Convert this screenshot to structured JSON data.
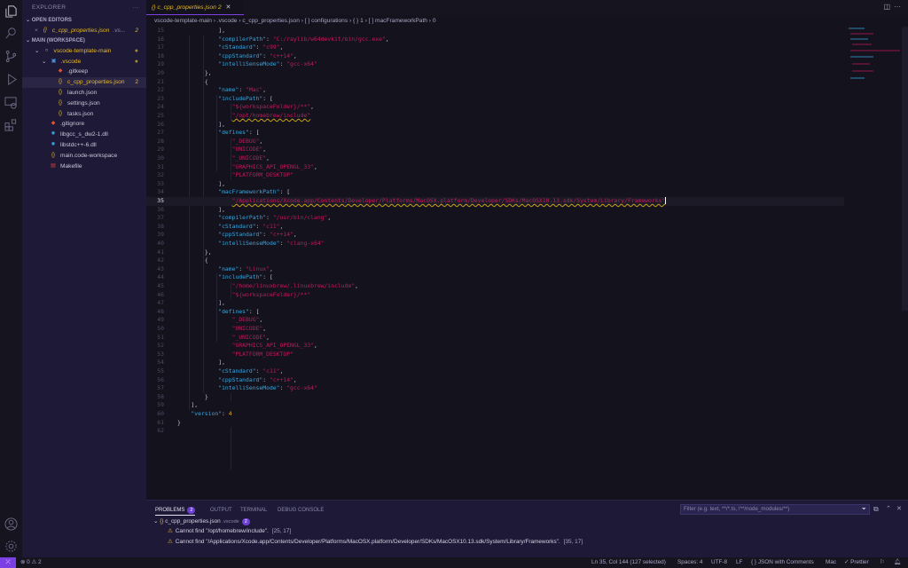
{
  "activity": [
    "explorer-icon",
    "search-icon",
    "source-control-icon",
    "run-debug-icon",
    "remote-explorer-icon",
    "extensions-icon",
    "account-icon",
    "settings-gear-icon"
  ],
  "sidebar": {
    "title": "EXPLORER",
    "more": "···",
    "open_editors": "OPEN EDITORS",
    "open_file": {
      "name": "c_cpp_properties.json",
      "dir": ".vs...",
      "count": "2"
    },
    "workspace": "MAIN (WORKSPACE)",
    "tree": [
      {
        "label": "vscode-template-main",
        "depth": 1,
        "icon": "○",
        "cls": "yellow",
        "dot": "●"
      },
      {
        "label": ".vscode",
        "depth": 2,
        "icon": "▣",
        "cls": "yellow",
        "dot": "●",
        "iconcolor": "#4a8fd6"
      },
      {
        "label": ".gitkeep",
        "depth": 3,
        "icon": "◆",
        "iconcolor": "#e0532e"
      },
      {
        "label": "c_cpp_properties.json",
        "depth": 3,
        "icon": "{}",
        "cls": "yellow",
        "count": "2",
        "selected": true,
        "iconcolor": "#e8b923"
      },
      {
        "label": "launch.json",
        "depth": 3,
        "icon": "{}",
        "iconcolor": "#e8b923"
      },
      {
        "label": "settings.json",
        "depth": 3,
        "icon": "{}",
        "iconcolor": "#e8b923"
      },
      {
        "label": "tasks.json",
        "depth": 3,
        "icon": "{}",
        "iconcolor": "#e8b923"
      },
      {
        "label": ".gitignore",
        "depth": 2,
        "icon": "◆",
        "iconcolor": "#e0532e"
      },
      {
        "label": "libgcc_s_dw2-1.dll",
        "depth": 2,
        "icon": "✹",
        "iconcolor": "#3a9de0"
      },
      {
        "label": "libstdc++-6.dll",
        "depth": 2,
        "icon": "✹",
        "iconcolor": "#3a9de0"
      },
      {
        "label": "main.code-workspace",
        "depth": 2,
        "icon": "{}",
        "iconcolor": "#e8b923"
      },
      {
        "label": "Makefile",
        "depth": 2,
        "icon": "▤",
        "iconcolor": "#e0403a"
      }
    ]
  },
  "tab": {
    "label": "c_cpp_properties.json",
    "count": "2"
  },
  "breadcrumb": [
    "vscode-template-main",
    ".vscode",
    "c_cpp_properties.json",
    "[ ] configurations",
    "{ } 1",
    "[ ] macFrameworkPath",
    "0"
  ],
  "code": [
    {
      "n": 15,
      "i": 12,
      "t": [
        [
          "p",
          "],"
        ]
      ]
    },
    {
      "n": 16,
      "i": 12,
      "t": [
        [
          "k",
          "\"compilerPath\""
        ],
        [
          "p",
          ": "
        ],
        [
          "s",
          "\"C:/raylib/w64devkit/bin/gcc.exe\""
        ],
        [
          "p",
          ","
        ]
      ]
    },
    {
      "n": 17,
      "i": 12,
      "t": [
        [
          "k",
          "\"cStandard\""
        ],
        [
          "p",
          ": "
        ],
        [
          "s",
          "\"c99\""
        ],
        [
          "p",
          ","
        ]
      ]
    },
    {
      "n": 18,
      "i": 12,
      "t": [
        [
          "k",
          "\"cppStandard\""
        ],
        [
          "p",
          ": "
        ],
        [
          "s",
          "\"c++14\""
        ],
        [
          "p",
          ","
        ]
      ]
    },
    {
      "n": 19,
      "i": 12,
      "t": [
        [
          "k",
          "\"intelliSenseMode\""
        ],
        [
          "p",
          ": "
        ],
        [
          "s",
          "\"gcc-x64\""
        ]
      ]
    },
    {
      "n": 20,
      "i": 8,
      "t": [
        [
          "p",
          "},"
        ]
      ]
    },
    {
      "n": 21,
      "i": 8,
      "t": [
        [
          "p",
          "{"
        ]
      ]
    },
    {
      "n": 22,
      "i": 12,
      "t": [
        [
          "k",
          "\"name\""
        ],
        [
          "p",
          ": "
        ],
        [
          "s",
          "\"Mac\""
        ],
        [
          "p",
          ","
        ]
      ]
    },
    {
      "n": 23,
      "i": 12,
      "t": [
        [
          "k",
          "\"includePath\""
        ],
        [
          "p",
          ": ["
        ]
      ]
    },
    {
      "n": 24,
      "i": 16,
      "t": [
        [
          "s",
          "\"${workspaceFolder}/**\""
        ],
        [
          "p",
          ","
        ]
      ]
    },
    {
      "n": 25,
      "i": 16,
      "t": [
        [
          "s sq",
          "\"/opt/homebrew/include\""
        ]
      ]
    },
    {
      "n": 26,
      "i": 12,
      "t": [
        [
          "p",
          "],"
        ]
      ]
    },
    {
      "n": 27,
      "i": 12,
      "t": [
        [
          "k",
          "\"defines\""
        ],
        [
          "p",
          ": ["
        ]
      ]
    },
    {
      "n": 28,
      "i": 16,
      "t": [
        [
          "s",
          "\"_DEBUG\""
        ],
        [
          "p",
          ","
        ]
      ]
    },
    {
      "n": 29,
      "i": 16,
      "t": [
        [
          "s",
          "\"UNICODE\""
        ],
        [
          "p",
          ","
        ]
      ]
    },
    {
      "n": 30,
      "i": 16,
      "t": [
        [
          "s",
          "\"_UNICODE\""
        ],
        [
          "p",
          ","
        ]
      ]
    },
    {
      "n": 31,
      "i": 16,
      "t": [
        [
          "s",
          "\"GRAPHICS_API_OPENGL_33\""
        ],
        [
          "p",
          ","
        ]
      ]
    },
    {
      "n": 32,
      "i": 16,
      "t": [
        [
          "s",
          "\"PLATFORM_DESKTOP\""
        ]
      ]
    },
    {
      "n": 33,
      "i": 12,
      "t": [
        [
          "p",
          "],"
        ]
      ]
    },
    {
      "n": 34,
      "i": 12,
      "t": [
        [
          "k",
          "\"macFrameworkPath\""
        ],
        [
          "p",
          ": ["
        ]
      ]
    },
    {
      "n": 35,
      "i": 16,
      "cur": true,
      "t": [
        [
          "s sq",
          "\"/Applications/Xcode.app/Contents/Developer/Platforms/MacOSX.platform/Developer/SDKs/MacOSX10.13.sdk/System/Library/Frameworks\""
        ]
      ]
    },
    {
      "n": 36,
      "i": 12,
      "t": [
        [
          "p",
          "],"
        ]
      ]
    },
    {
      "n": 37,
      "i": 12,
      "t": [
        [
          "k",
          "\"compilerPath\""
        ],
        [
          "p",
          ": "
        ],
        [
          "s",
          "\"/usr/bin/clang\""
        ],
        [
          "p",
          ","
        ]
      ]
    },
    {
      "n": 38,
      "i": 12,
      "t": [
        [
          "k",
          "\"cStandard\""
        ],
        [
          "p",
          ": "
        ],
        [
          "s",
          "\"c11\""
        ],
        [
          "p",
          ","
        ]
      ]
    },
    {
      "n": 39,
      "i": 12,
      "t": [
        [
          "k",
          "\"cppStandard\""
        ],
        [
          "p",
          ": "
        ],
        [
          "s",
          "\"c++14\""
        ],
        [
          "p",
          ","
        ]
      ]
    },
    {
      "n": 40,
      "i": 12,
      "t": [
        [
          "k",
          "\"intelliSenseMode\""
        ],
        [
          "p",
          ": "
        ],
        [
          "s",
          "\"clang-x64\""
        ]
      ]
    },
    {
      "n": 41,
      "i": 8,
      "t": [
        [
          "p",
          "},"
        ]
      ]
    },
    {
      "n": 42,
      "i": 8,
      "t": [
        [
          "p",
          "{"
        ]
      ]
    },
    {
      "n": 43,
      "i": 12,
      "t": [
        [
          "k",
          "\"name\""
        ],
        [
          "p",
          ": "
        ],
        [
          "s",
          "\"Linux\""
        ],
        [
          "p",
          ","
        ]
      ]
    },
    {
      "n": 44,
      "i": 12,
      "t": [
        [
          "k",
          "\"includePath\""
        ],
        [
          "p",
          ": ["
        ]
      ]
    },
    {
      "n": 45,
      "i": 16,
      "t": [
        [
          "s",
          "\"/home/linuxbrew/.linuxbrew/include\""
        ],
        [
          "p",
          ","
        ]
      ]
    },
    {
      "n": 46,
      "i": 16,
      "t": [
        [
          "s",
          "\"${workspaceFolder}/**\""
        ]
      ]
    },
    {
      "n": 47,
      "i": 12,
      "t": [
        [
          "p",
          "],"
        ]
      ]
    },
    {
      "n": 48,
      "i": 12,
      "t": [
        [
          "k",
          "\"defines\""
        ],
        [
          "p",
          ": ["
        ]
      ]
    },
    {
      "n": 49,
      "i": 16,
      "t": [
        [
          "s",
          "\"_DEBUG\""
        ],
        [
          "p",
          ","
        ]
      ]
    },
    {
      "n": 50,
      "i": 16,
      "t": [
        [
          "s",
          "\"UNICODE\""
        ],
        [
          "p",
          ","
        ]
      ]
    },
    {
      "n": 51,
      "i": 16,
      "t": [
        [
          "s",
          "\"_UNICODE\""
        ],
        [
          "p",
          ","
        ]
      ]
    },
    {
      "n": 52,
      "i": 16,
      "t": [
        [
          "s",
          "\"GRAPHICS_API_OPENGL_33\""
        ],
        [
          "p",
          ","
        ]
      ]
    },
    {
      "n": 53,
      "i": 16,
      "t": [
        [
          "s",
          "\"PLATFORM_DESKTOP\""
        ]
      ]
    },
    {
      "n": 54,
      "i": 12,
      "t": [
        [
          "p",
          "],"
        ]
      ]
    },
    {
      "n": 55,
      "i": 12,
      "t": [
        [
          "k",
          "\"cStandard\""
        ],
        [
          "p",
          ": "
        ],
        [
          "s",
          "\"c11\""
        ],
        [
          "p",
          ","
        ]
      ]
    },
    {
      "n": 56,
      "i": 12,
      "t": [
        [
          "k",
          "\"cppStandard\""
        ],
        [
          "p",
          ": "
        ],
        [
          "s",
          "\"c++14\""
        ],
        [
          "p",
          ","
        ]
      ]
    },
    {
      "n": 57,
      "i": 12,
      "t": [
        [
          "k",
          "\"intelliSenseMode\""
        ],
        [
          "p",
          ": "
        ],
        [
          "s",
          "\"gcc-x64\""
        ]
      ]
    },
    {
      "n": 58,
      "i": 8,
      "t": [
        [
          "p",
          "}"
        ]
      ]
    },
    {
      "n": 59,
      "i": 4,
      "t": [
        [
          "p",
          "],"
        ]
      ]
    },
    {
      "n": 60,
      "i": 4,
      "t": [
        [
          "k",
          "\"version\""
        ],
        [
          "p",
          ": "
        ],
        [
          "n",
          "4"
        ]
      ]
    },
    {
      "n": 61,
      "i": 0,
      "t": [
        [
          "p",
          "}"
        ]
      ]
    },
    {
      "n": 62,
      "i": 0,
      "t": []
    }
  ],
  "panel": {
    "tabs": [
      "PROBLEMS",
      "OUTPUT",
      "TERMINAL",
      "DEBUG CONSOLE"
    ],
    "problems_count": "2",
    "filter_placeholder": "Filter (e.g. text, **/*.ts, !**/node_modules/**)",
    "file": {
      "name": "c_cpp_properties.json",
      "dir": ".vscode",
      "count": "2"
    },
    "problems": [
      {
        "msg": "Cannot find \"/opt/homebrew/include\".",
        "loc": "[25, 17]"
      },
      {
        "msg": "Cannot find \"/Applications/Xcode.app/Contents/Developer/Platforms/MacOSX.platform/Developer/SDKs/MacOSX10.13.sdk/System/Library/Frameworks\".",
        "loc": "[35, 17]"
      }
    ]
  },
  "status": {
    "errors": "0",
    "warnings": "2",
    "position": "Ln 35, Col 144 (127 selected)",
    "spaces": "Spaces: 4",
    "encoding": "UTF-8",
    "eol": "LF",
    "language": "{ }  JSON with Comments",
    "config": "Mac",
    "prettier": "✓ Prettier"
  },
  "colors": {
    "accent": "#7b3fe4",
    "sidebar": "#1d1937",
    "editor": "#14121c"
  }
}
